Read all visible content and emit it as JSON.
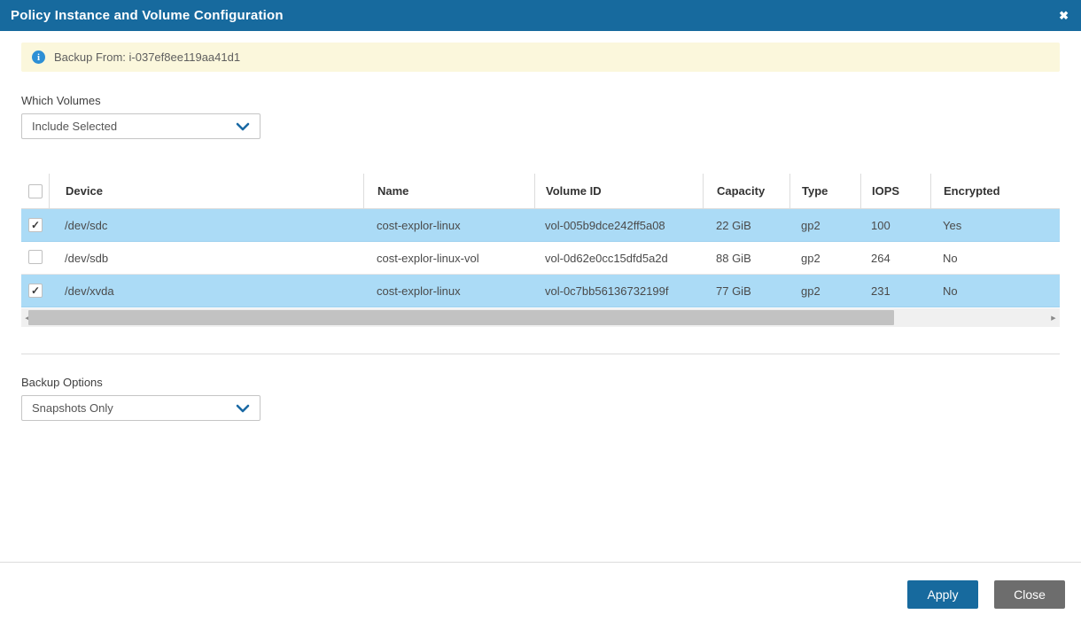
{
  "modal": {
    "title": "Policy Instance and Volume Configuration",
    "close_icon_glyph": "✖"
  },
  "banner": {
    "info_icon_glyph": "i",
    "text": "Backup From: i-037ef8ee119aa41d1"
  },
  "which_volumes": {
    "label": "Which Volumes",
    "selected": "Include Selected"
  },
  "backup_options": {
    "label": "Backup Options",
    "selected": "Snapshots Only"
  },
  "table": {
    "columns": {
      "device": "Device",
      "name": "Name",
      "volume_id": "Volume ID",
      "capacity": "Capacity",
      "type": "Type",
      "iops": "IOPS",
      "encrypted": "Encrypted"
    },
    "rows": [
      {
        "checked": true,
        "device": "/dev/sdc",
        "name": "cost-explor-linux",
        "volume_id": "vol-005b9dce242ff5a08",
        "capacity": "22 GiB",
        "type": "gp2",
        "iops": "100",
        "encrypted": "Yes"
      },
      {
        "checked": false,
        "device": "/dev/sdb",
        "name": "cost-explor-linux-vol",
        "volume_id": "vol-0d62e0cc15dfd5a2d",
        "capacity": "88 GiB",
        "type": "gp2",
        "iops": "264",
        "encrypted": "No"
      },
      {
        "checked": true,
        "device": "/dev/xvda",
        "name": "cost-explor-linux",
        "volume_id": "vol-0c7bb56136732199f",
        "capacity": "77 GiB",
        "type": "gp2",
        "iops": "231",
        "encrypted": "No"
      }
    ]
  },
  "footer": {
    "apply_label": "Apply",
    "close_label": "Close"
  },
  "colors": {
    "header_bg": "#176a9e",
    "banner_bg": "#fbf7dc",
    "row_highlight": "#abdbf6",
    "accent_blue": "#1a69a4",
    "apply_bg": "#176a9e",
    "close_bg": "#6d6d6d"
  }
}
